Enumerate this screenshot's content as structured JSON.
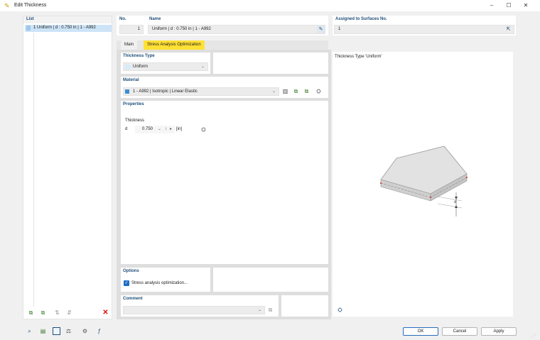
{
  "window": {
    "title": "Edit Thickness",
    "minimize": "–",
    "maximize": "☐",
    "close": "✕"
  },
  "list": {
    "header": "List",
    "items": [
      {
        "label": "1  Uniform | d : 0.750 in | 1 - A992"
      }
    ]
  },
  "header": {
    "no_label": "No.",
    "no_value": "1",
    "name_label": "Name",
    "name_value": "Uniform | d : 0.750 in | 1 - A992",
    "assigned_label": "Assigned to Surfaces No.",
    "assigned_value": "1"
  },
  "tabs": [
    {
      "label": "Main"
    },
    {
      "label": "Stress Analysis Optimization"
    }
  ],
  "thickness_type": {
    "label": "Thickness Type",
    "value": "Uniform"
  },
  "material": {
    "label": "Material",
    "value": "1 - A992 | Isotropic | Linear Elastic",
    "color": "#3d8fd1"
  },
  "properties": {
    "label": "Properties",
    "thickness_label": "Thickness",
    "symbol": "d",
    "value": "0.750",
    "unit": "[in]"
  },
  "options": {
    "label": "Options",
    "checkbox_label": "Stress analysis optimization...",
    "checked": true
  },
  "comment": {
    "label": "Comment",
    "value": ""
  },
  "preview": {
    "title": "Thickness Type  'Uniform'",
    "dim_label": "d"
  },
  "buttons": {
    "ok": "OK",
    "cancel": "Cancel",
    "apply": "Apply"
  },
  "colors": {
    "accent": "#1f4e79",
    "tab_active": "#ffe135",
    "selection": "#cde4f7",
    "delete": "#d11"
  }
}
